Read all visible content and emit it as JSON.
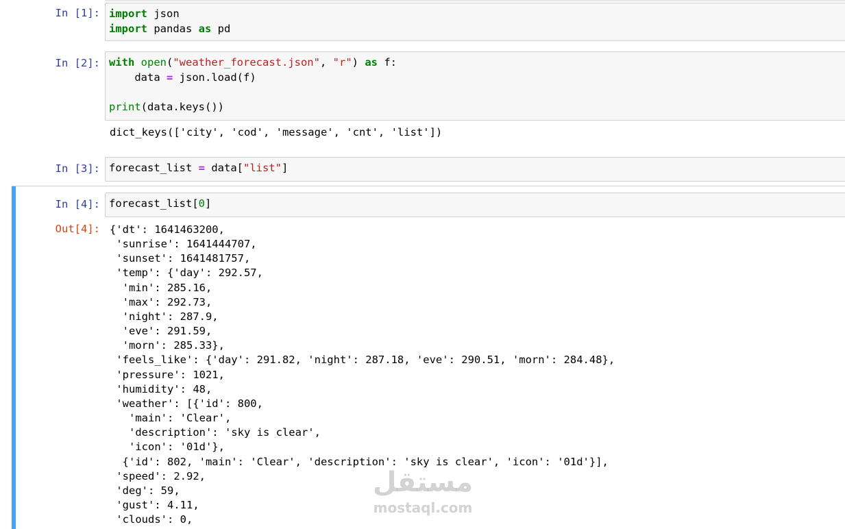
{
  "cells": [
    {
      "prompt": "In [1]:",
      "lines": [
        [
          {
            "t": "import",
            "c": "kw"
          },
          {
            "t": " json"
          }
        ],
        [
          {
            "t": "import",
            "c": "kw"
          },
          {
            "t": " pandas "
          },
          {
            "t": "as",
            "c": "kw"
          },
          {
            "t": " pd"
          }
        ]
      ]
    },
    {
      "prompt": "In [2]:",
      "lines": [
        [
          {
            "t": "with",
            "c": "kw"
          },
          {
            "t": " "
          },
          {
            "t": "open",
            "c": "bi"
          },
          {
            "t": "("
          },
          {
            "t": "\"weather_forecast.json\"",
            "c": "str"
          },
          {
            "t": ", "
          },
          {
            "t": "\"r\"",
            "c": "str"
          },
          {
            "t": ") "
          },
          {
            "t": "as",
            "c": "kw"
          },
          {
            "t": " f:"
          }
        ],
        [
          {
            "t": "    data "
          },
          {
            "t": "=",
            "c": "op"
          },
          {
            "t": " json.load(f)"
          }
        ],
        [
          {
            "t": ""
          }
        ],
        [
          {
            "t": "print",
            "c": "bi"
          },
          {
            "t": "(data.keys())"
          }
        ]
      ],
      "output": "dict_keys(['city', 'cod', 'message', 'cnt', 'list'])"
    },
    {
      "prompt": "In [3]:",
      "lines": [
        [
          {
            "t": "forecast_list "
          },
          {
            "t": "=",
            "c": "op"
          },
          {
            "t": " data["
          },
          {
            "t": "\"list\"",
            "c": "str"
          },
          {
            "t": "]"
          }
        ]
      ]
    },
    {
      "prompt": "In [4]:",
      "lines": [
        [
          {
            "t": "forecast_list["
          },
          {
            "t": "0",
            "c": "num"
          },
          {
            "t": "]"
          }
        ]
      ],
      "out_prompt": "Out[4]:",
      "output_lines": [
        "{'dt': 1641463200,",
        " 'sunrise': 1641444707,",
        " 'sunset': 1641481757,",
        " 'temp': {'day': 292.57,",
        "  'min': 285.16,",
        "  'max': 292.73,",
        "  'night': 287.9,",
        "  'eve': 291.59,",
        "  'morn': 285.33},",
        " 'feels_like': {'day': 291.82, 'night': 287.18, 'eve': 290.51, 'morn': 284.48},",
        " 'pressure': 1021,",
        " 'humidity': 48,",
        " 'weather': [{'id': 800,",
        "   'main': 'Clear',",
        "   'description': 'sky is clear',",
        "   'icon': '01d'},",
        "  {'id': 802, 'main': 'Clear', 'description': 'sky is clear', 'icon': '01d'}],",
        " 'speed': 2.92,",
        " 'deg': 59,",
        " 'gust': 4.11,",
        " 'clouds': 0,"
      ]
    }
  ],
  "watermark": {
    "arabic": "مستقل",
    "latin": "mostaql.com"
  }
}
